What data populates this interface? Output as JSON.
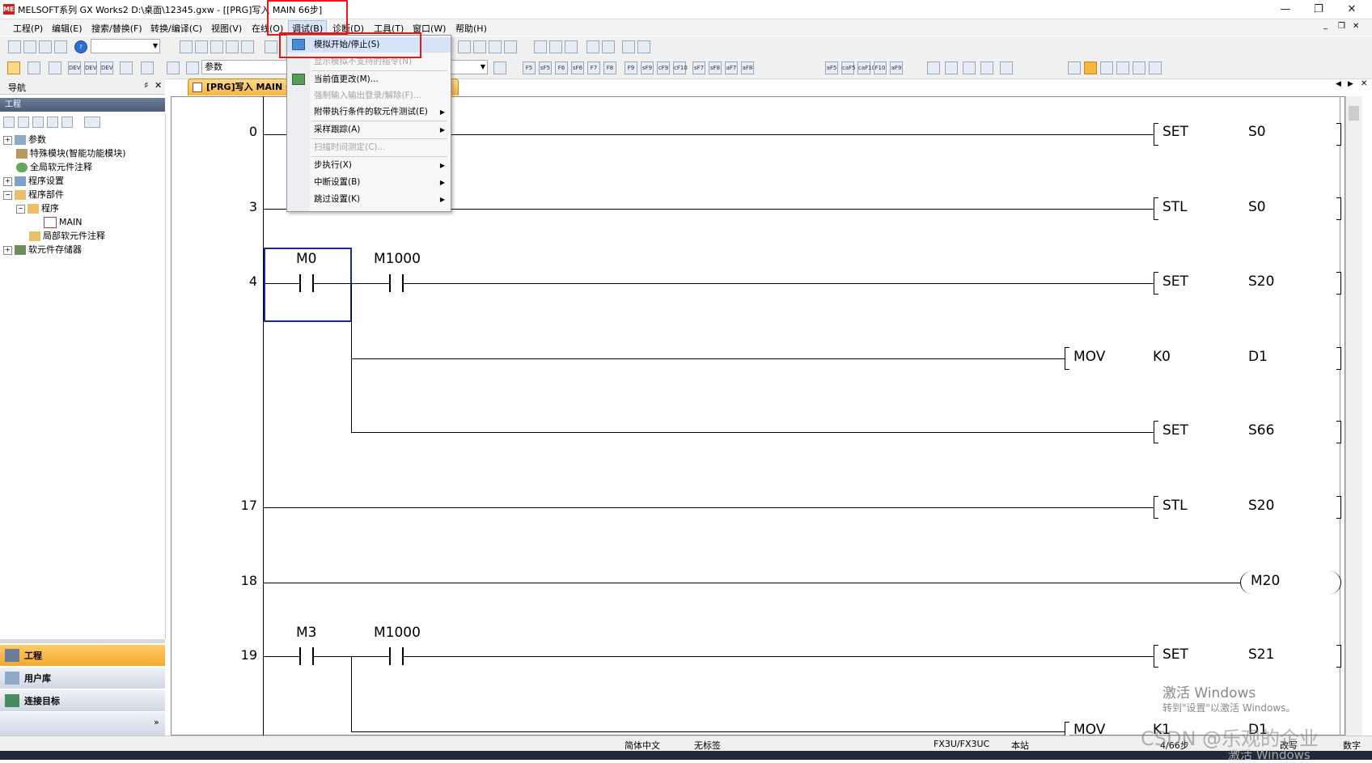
{
  "window": {
    "title": "MELSOFT系列 GX Works2 D:\\桌面\\12345.gxw - [[PRG]写入 MAIN 66步]",
    "logo": "MEL",
    "controls": {
      "minimize": "—",
      "restore": "❐",
      "close": "✕"
    }
  },
  "menubar": {
    "items": [
      "工程(P)",
      "编辑(E)",
      "搜索/替换(F)",
      "转换/编译(C)",
      "视图(V)",
      "在线(O)",
      "调试(B)",
      "诊断(D)",
      "工具(T)",
      "窗口(W)",
      "帮助(H)"
    ],
    "active": "调试(B)",
    "doc_controls": {
      "minimize": "_",
      "restore": "❐",
      "close": "✕"
    }
  },
  "toolbar": {
    "instruction_combo": "参数"
  },
  "left_panel": {
    "nav_title": "导航",
    "pin": "♯",
    "close": "✕",
    "project_header": "工程",
    "tree": [
      {
        "label": "参数",
        "level": 0,
        "expander": "+"
      },
      {
        "label": "特殊模块(智能功能模块)",
        "level": 0,
        "expander": ""
      },
      {
        "label": "全局软元件注释",
        "level": 0,
        "expander": ""
      },
      {
        "label": "程序设置",
        "level": 0,
        "expander": "+"
      },
      {
        "label": "程序部件",
        "level": 0,
        "expander": "−"
      },
      {
        "label": "程序",
        "level": 1,
        "expander": "−"
      },
      {
        "label": "MAIN",
        "level": 2,
        "expander": ""
      },
      {
        "label": "局部软元件注释",
        "level": 1,
        "expander": ""
      },
      {
        "label": "软元件存储器",
        "level": 0,
        "expander": "+"
      }
    ],
    "nav_buttons": [
      "工程",
      "用户库",
      "连接目标"
    ],
    "more": "»"
  },
  "editor": {
    "tab_label": "[PRG]写入 MAIN 66",
    "tab_arrows": [
      "◀",
      "▶",
      "✕"
    ]
  },
  "ladder": {
    "rungs": [
      {
        "step": "0",
        "instr": "SET",
        "op1": "S0"
      },
      {
        "step": "3",
        "instr": "STL",
        "op1": "S0"
      },
      {
        "step": "4",
        "contacts": [
          "M0",
          "M1000"
        ],
        "instr": "SET",
        "op1": "S20"
      },
      {
        "step": "",
        "instr": "MOV",
        "op1": "K0",
        "op2": "D1"
      },
      {
        "step": "",
        "instr": "SET",
        "op1": "S66"
      },
      {
        "step": "17",
        "instr": "STL",
        "op1": "S20"
      },
      {
        "step": "18",
        "coil": "M20"
      },
      {
        "step": "19",
        "contacts": [
          "M3",
          "M1000"
        ],
        "instr": "SET",
        "op1": "S21"
      },
      {
        "step": "",
        "instr": "MOV",
        "op1": "K1",
        "op2": "D1"
      }
    ]
  },
  "debug_menu": {
    "items": [
      {
        "label": "模拟开始/停止(S)",
        "disabled": false,
        "submenu": false
      },
      {
        "label": "显示模拟不支持的指令(N)",
        "disabled": true,
        "submenu": false
      },
      {
        "label": "当前值更改(M)...",
        "disabled": false,
        "submenu": false
      },
      {
        "label": "强制输入输出登录/解除(F)...",
        "disabled": true,
        "submenu": false
      },
      {
        "label": "附带执行条件的软元件测试(E)",
        "disabled": false,
        "submenu": true
      },
      {
        "label": "采样跟踪(A)",
        "disabled": false,
        "submenu": true
      },
      {
        "label": "扫描时间测定(C)...",
        "disabled": true,
        "submenu": false
      },
      {
        "label": "步执行(X)",
        "disabled": false,
        "submenu": true
      },
      {
        "label": "中断设置(B)",
        "disabled": false,
        "submenu": true
      },
      {
        "label": "跳过设置(K)",
        "disabled": false,
        "submenu": true
      }
    ]
  },
  "statusbar": {
    "language": "简体中文",
    "label": "无标签",
    "plc": "FX3U/FX3UC",
    "station": "本站",
    "steps": "4/66步",
    "mode": "改写",
    "num": "数字"
  },
  "watermark": {
    "line1": "激活 Windows",
    "line2": "转到\"设置\"以激活 Windows。",
    "csdn": "CSDN @乐观的企业",
    "tail": "激活 Windows"
  },
  "colors": {
    "highlight_red": "#e21a1a",
    "selected_cell": "#1b2a8c",
    "tab_orange": "#f5b640",
    "nav_active": "#f3a92c"
  }
}
